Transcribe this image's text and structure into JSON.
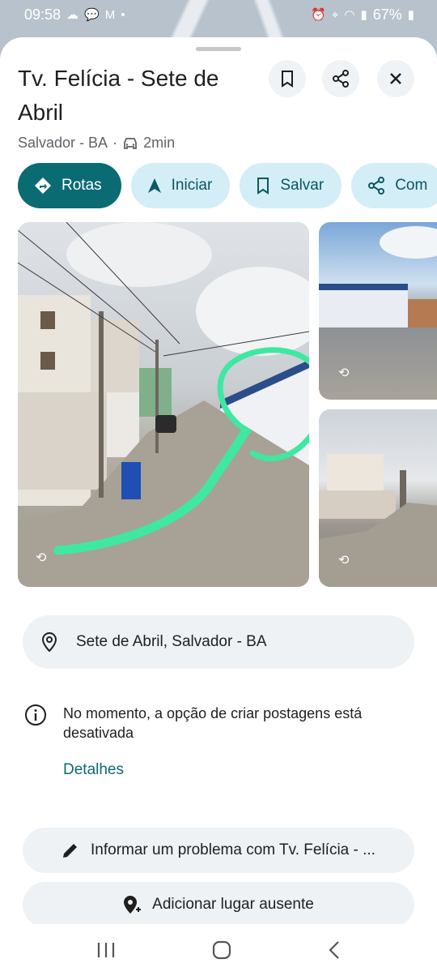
{
  "status_bar": {
    "time": "09:58",
    "battery": "67%"
  },
  "place": {
    "title": "Tv. Felícia - Sete de Abril",
    "subtitle_location": "Salvador - BA",
    "travel_time": "2min"
  },
  "actions": {
    "directions_label": "Rotas",
    "start_label": "Iniciar",
    "save_label": "Salvar",
    "share_label": "Com"
  },
  "address": {
    "text": "Sete de Abril, Salvador - BA"
  },
  "notice": {
    "text": "No momento, a opção de criar postagens está desativada",
    "details_label": "Detalhes"
  },
  "bottom_actions": {
    "report_label": "Informar um problema com Tv. Felícia - ...",
    "add_place_label": "Adicionar lugar ausente"
  },
  "colors": {
    "primary": "#0b6b73",
    "chip_bg": "#d3eef6",
    "annotation": "#3ee8a0"
  }
}
